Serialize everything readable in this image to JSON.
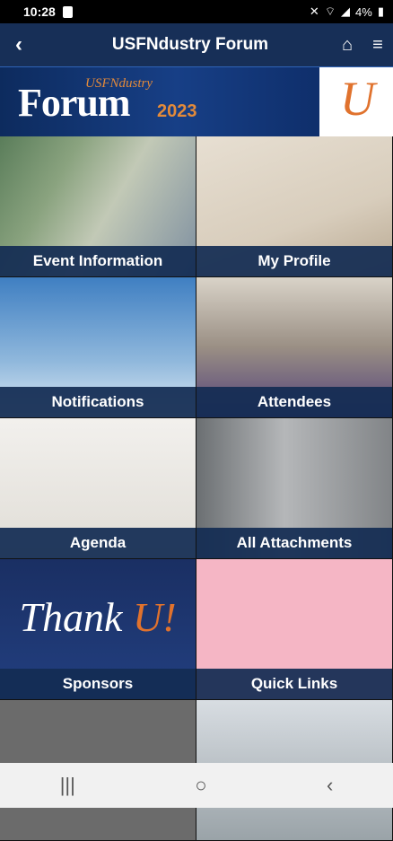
{
  "status": {
    "time": "10:28",
    "battery": "4%"
  },
  "app_bar": {
    "title": "USFNdustry Forum",
    "back_icon": "‹",
    "home_icon": "⌂",
    "menu_icon": "≡"
  },
  "banner": {
    "usf": "USFNdustry",
    "forum": "Forum",
    "year": "2023",
    "u": "U"
  },
  "tiles": [
    {
      "label": "Event Information"
    },
    {
      "label": "My Profile"
    },
    {
      "label": "Notifications"
    },
    {
      "label": "Attendees"
    },
    {
      "label": "Agenda"
    },
    {
      "label": "All Attachments"
    },
    {
      "label": "Sponsors"
    },
    {
      "label": "Quick Links"
    },
    {
      "label": ""
    },
    {
      "label": ""
    }
  ],
  "sponsor_art": {
    "thank": "Thank ",
    "u": "U!"
  },
  "nav": {
    "recents": "|||",
    "home": "○",
    "back": "‹"
  }
}
